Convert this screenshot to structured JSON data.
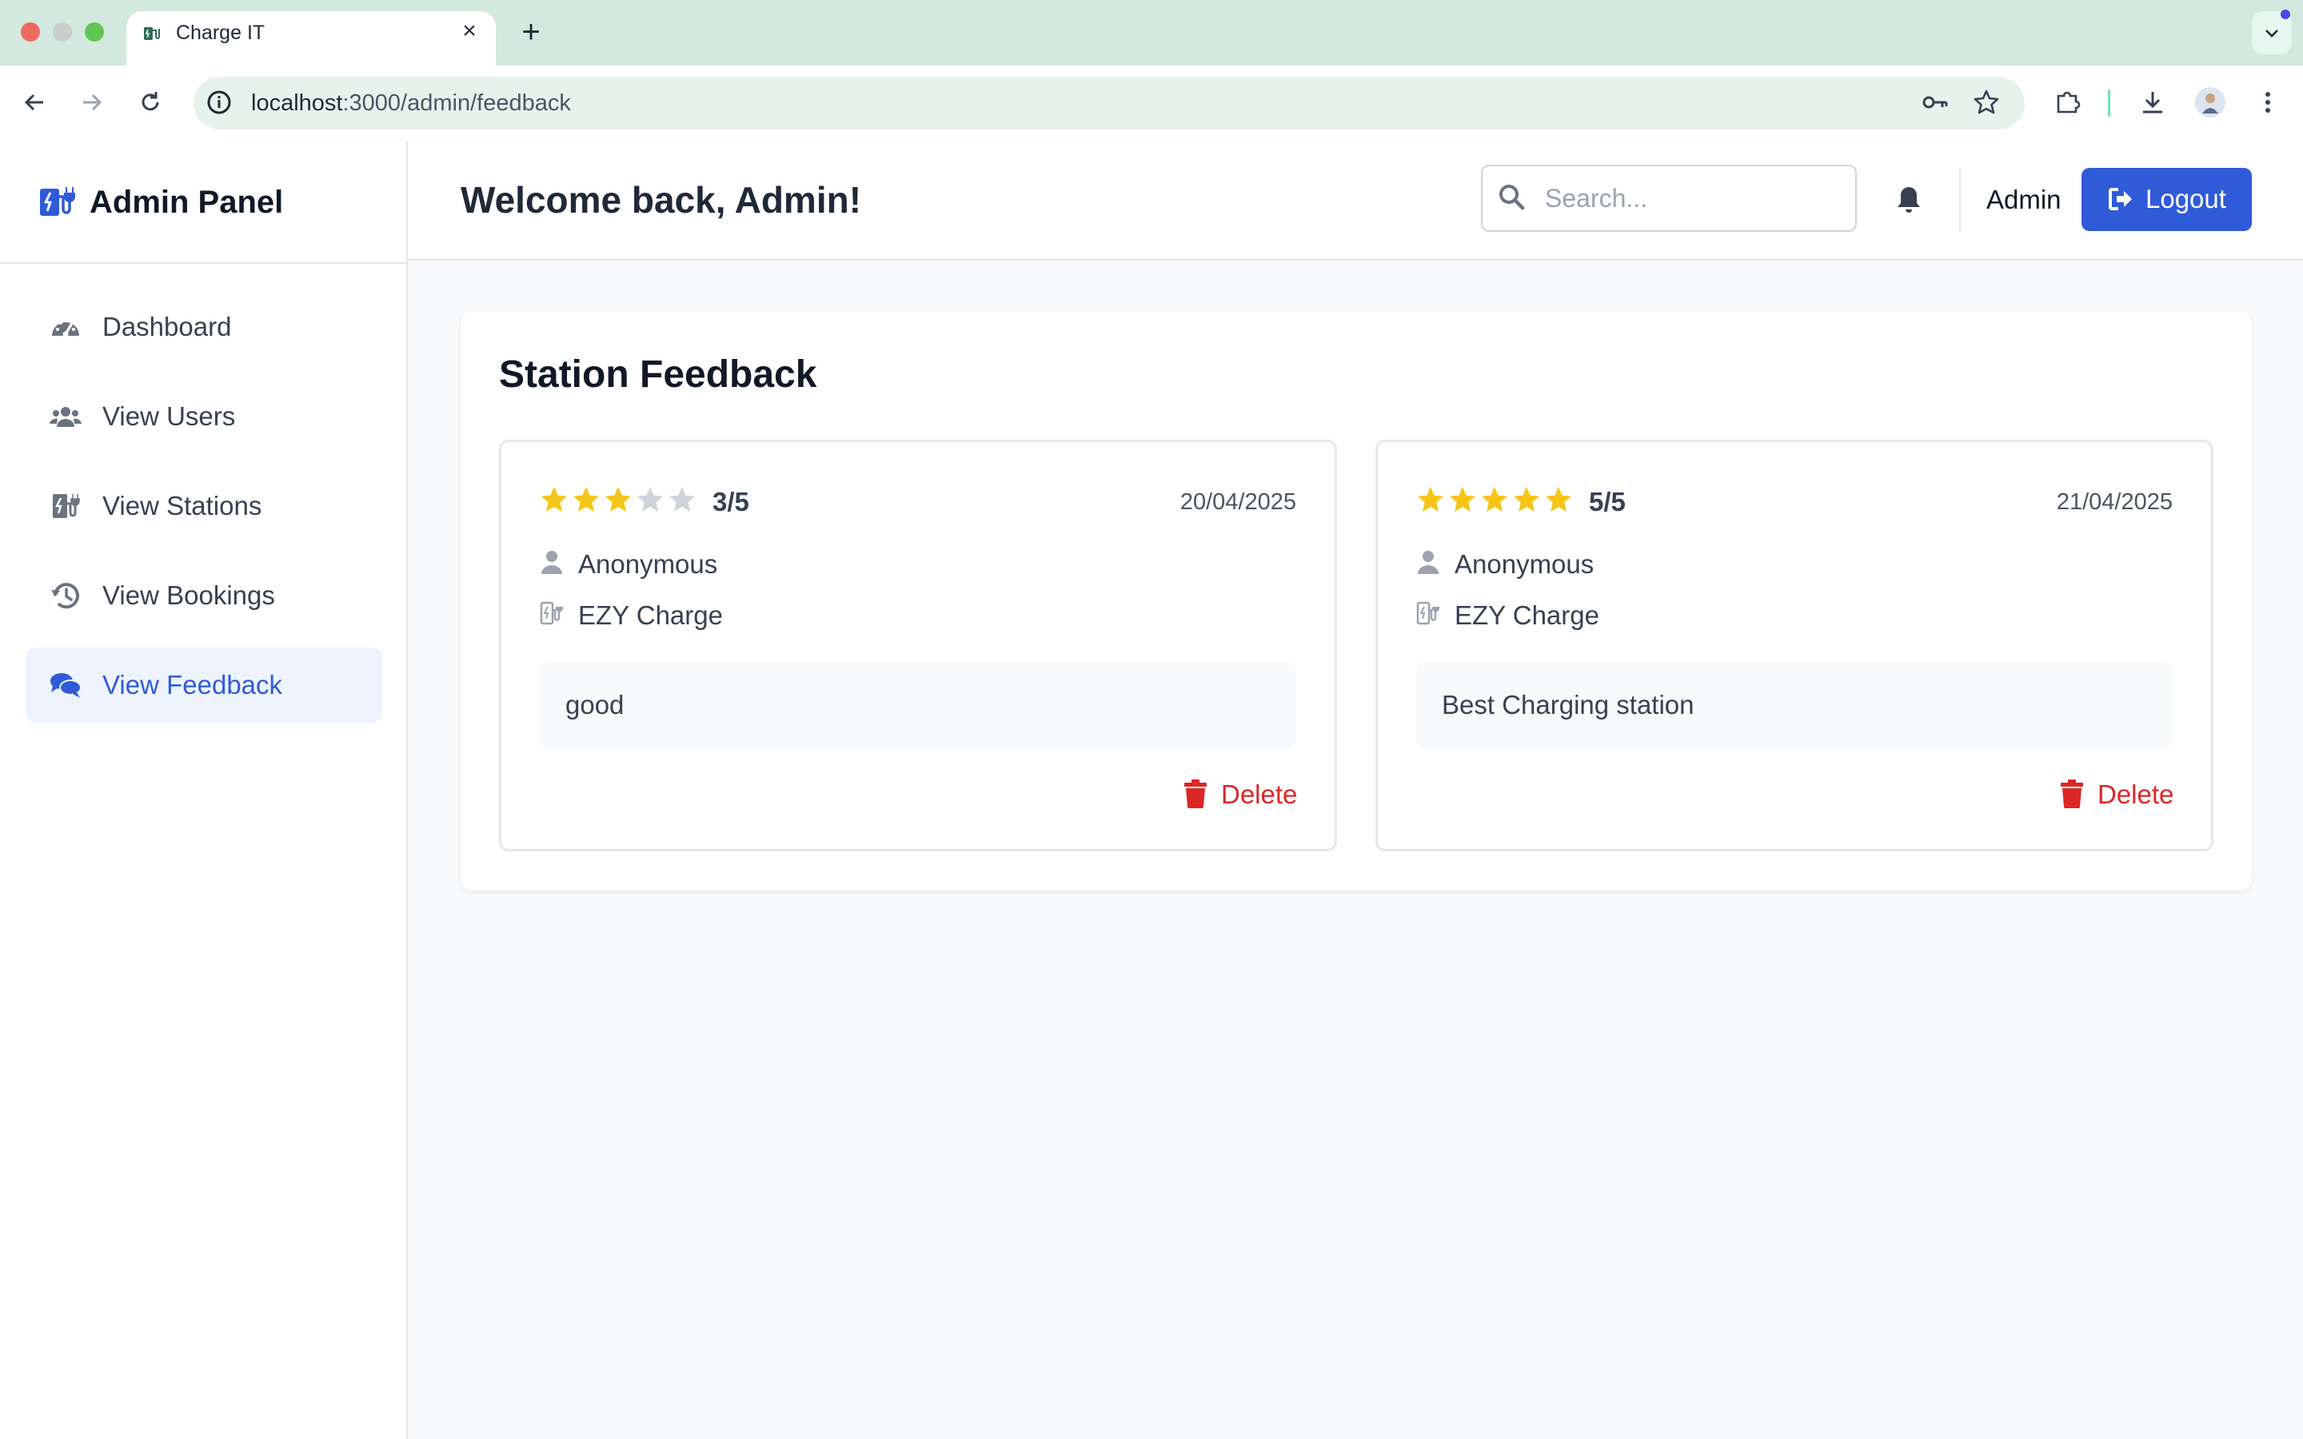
{
  "browser": {
    "tab_title": "Charge IT",
    "url_host": "localhost",
    "url_path": ":3000/admin/feedback"
  },
  "sidebar": {
    "brand": "Admin Panel",
    "items": [
      {
        "label": "Dashboard",
        "icon": "gauge-icon",
        "active": false
      },
      {
        "label": "View Users",
        "icon": "users-icon",
        "active": false
      },
      {
        "label": "View Stations",
        "icon": "charging-station-icon",
        "active": false
      },
      {
        "label": "View Bookings",
        "icon": "history-icon",
        "active": false
      },
      {
        "label": "View Feedback",
        "icon": "comments-icon",
        "active": true
      }
    ]
  },
  "header": {
    "welcome": "Welcome back, Admin!",
    "search_placeholder": "Search...",
    "user_name": "Admin",
    "logout_label": "Logout"
  },
  "main": {
    "title": "Station Feedback",
    "feedback": [
      {
        "rating": 3,
        "max": 5,
        "rating_text": "3/5",
        "date": "20/04/2025",
        "user": "Anonymous",
        "station": "EZY Charge",
        "comment": "good",
        "delete_label": "Delete"
      },
      {
        "rating": 5,
        "max": 5,
        "rating_text": "5/5",
        "date": "21/04/2025",
        "user": "Anonymous",
        "station": "EZY Charge",
        "comment": "Best Charging station",
        "delete_label": "Delete"
      }
    ]
  },
  "colors": {
    "accent": "#2f5bd8",
    "star_filled": "#f5c518",
    "star_empty": "#d1d5db",
    "danger": "#dc2626"
  }
}
